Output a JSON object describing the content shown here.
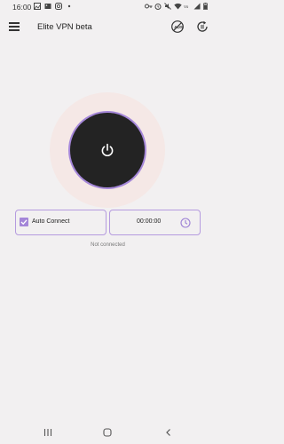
{
  "status_bar": {
    "time": "16:00",
    "icons_left": [
      "gallery-icon",
      "image-icon",
      "instagram-icon",
      "dot-icon"
    ],
    "icons_right": [
      "key-icon",
      "alarm-icon",
      "mute-icon",
      "wifi-icon",
      "volte-icon",
      "signal-icon",
      "battery-icon"
    ]
  },
  "app_bar": {
    "title": "Elite VPN beta",
    "menu_icon": "hamburger-menu-icon",
    "action_icons": [
      "no-ads-icon",
      "refresh-icon"
    ]
  },
  "power": {
    "icon": "power-icon"
  },
  "auto_connect": {
    "label": "Auto Connect",
    "checked": true
  },
  "timer": {
    "value": "00:00:00",
    "icon": "clock-icon"
  },
  "connection_status": "Not connected",
  "nav_bar": {
    "icons": [
      "recents-icon",
      "home-icon",
      "back-icon"
    ]
  },
  "colors": {
    "accent": "#a486d8",
    "button_dark": "#232323",
    "halo": "#f5e8e6",
    "background": "#f2f0f1"
  }
}
